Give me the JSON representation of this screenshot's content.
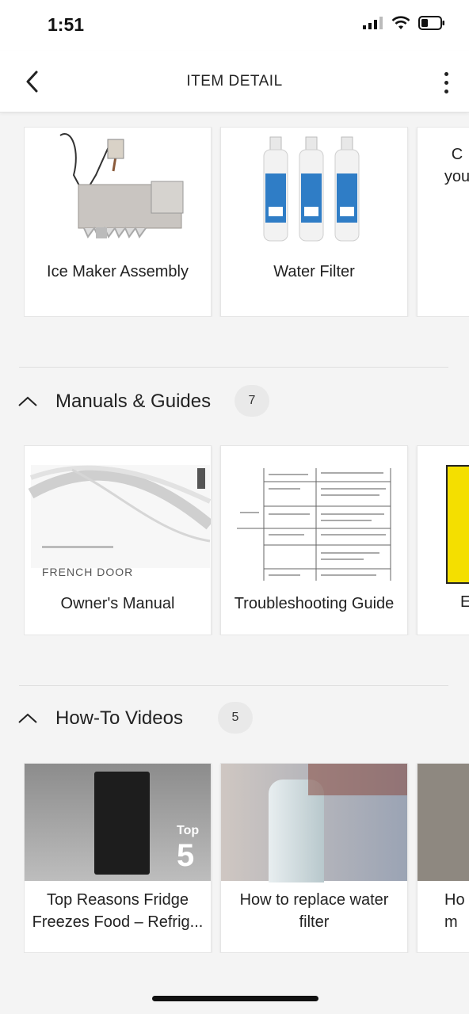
{
  "status_bar": {
    "time": "1:51"
  },
  "header": {
    "title": "ITEM DETAIL"
  },
  "parts": {
    "items": [
      {
        "label": "Ice Maker Assembly"
      },
      {
        "label": "Water Filter"
      },
      {
        "label_partial": "C you"
      }
    ]
  },
  "manuals": {
    "title": "Manuals & Guides",
    "count": "7",
    "items": [
      {
        "label": "Owner's Manual",
        "cover_text": "FRENCH DOOR"
      },
      {
        "label": "Troubleshooting Guide"
      },
      {
        "label_partial": "E"
      }
    ]
  },
  "videos": {
    "title": "How-To Videos",
    "count": "5",
    "items": [
      {
        "label": "Top Reasons Fridge Freezes Food – Refrig...",
        "thumb_badge_top": "Top",
        "thumb_badge_num": "5"
      },
      {
        "label": "How to replace water filter"
      },
      {
        "label_partial": "Ho m"
      }
    ]
  },
  "colors": {
    "accent_yellow": "#f4df00",
    "filter_blue": "#2f7dc6"
  }
}
